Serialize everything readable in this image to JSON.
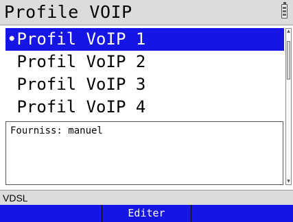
{
  "header": {
    "title": "Profile VOIP",
    "battery_icon": "battery-icon"
  },
  "list": {
    "items": [
      {
        "label": "•Profil VoIP 1",
        "selected": true
      },
      {
        "label": " Profil VoIP 2",
        "selected": false
      },
      {
        "label": " Profil VoIP 3",
        "selected": false
      },
      {
        "label": " Profil VoIP 4",
        "selected": false
      }
    ]
  },
  "info": {
    "text": "Fourniss: manuel"
  },
  "status": {
    "text": "VDSL"
  },
  "softkeys": {
    "left": "",
    "center": "Editer",
    "right": ""
  },
  "colors": {
    "accent": "#1515e6",
    "titlebar": "#dcdcdc"
  }
}
